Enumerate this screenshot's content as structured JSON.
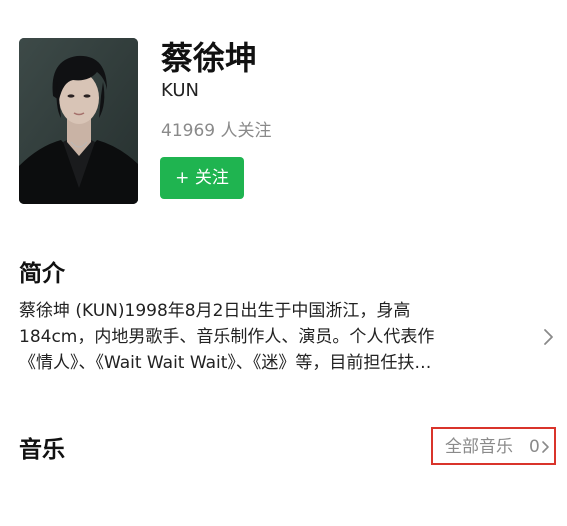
{
  "artist": {
    "name": "蔡徐坤",
    "alias": "KUN",
    "followers": "41969 人关注",
    "follow_button_label": "+ 关注",
    "photo_icon": "artist-portrait"
  },
  "intro": {
    "title": "简介",
    "lines": [
      "蔡徐坤 (KUN)1998年8月2日出生于中国浙江，身高",
      "184cm，内地男歌手、音乐制作人、演员。个人代表作",
      "《情人》、《Wait Wait Wait》、《迷》等，目前担任扶…"
    ],
    "arrow_icon": "chevron-right-icon"
  },
  "music": {
    "title": "音乐",
    "all_music_label": "全部音乐",
    "all_music_count": "0",
    "chevron_icon": "chevron-right-icon"
  },
  "colors": {
    "follow_button": "#1fb450",
    "highlight_border": "#d9342b",
    "secondary_text": "#8a8a8a"
  }
}
